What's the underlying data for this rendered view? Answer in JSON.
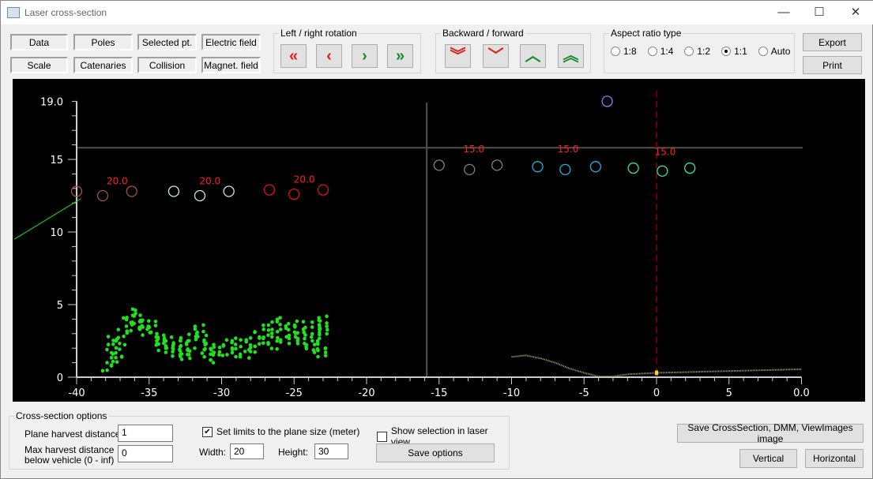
{
  "window": {
    "title": "Laser cross-section",
    "minimize": "—",
    "maximize": "☐",
    "close": "✕"
  },
  "toggles": {
    "data": "Data",
    "poles": "Poles",
    "selected": "Selected pt.",
    "electric": "Electric field",
    "scale": "Scale",
    "catenaries": "Catenaries",
    "collision": "Collision",
    "magnet": "Magnet. field"
  },
  "rotation": {
    "label": "Left / right rotation",
    "buttons": [
      "«",
      "‹",
      "›",
      "»"
    ]
  },
  "backfwd": {
    "label": "Backward / forward",
    "buttons": [
      "︾",
      "﹀",
      "︿",
      "︽"
    ]
  },
  "aspect": {
    "label": "Aspect ratio type",
    "options": [
      "1:8",
      "1:4",
      "1:2",
      "1:1",
      "Auto"
    ],
    "selected": "1:1"
  },
  "actions": {
    "export": "Export",
    "print": "Print"
  },
  "chart_data": {
    "type": "scatter",
    "xlim": [
      -40,
      10
    ],
    "ylim": [
      0,
      19
    ],
    "x_ticks": [
      "-40",
      "-35",
      "-30",
      "-25",
      "-20",
      "-15",
      "-10",
      "-5",
      "0",
      "5",
      "0.0"
    ],
    "y_ticks": [
      "0",
      "5",
      "10",
      "15",
      "19.0"
    ],
    "crosshair": {
      "x": -15.85,
      "y": 15.8
    },
    "vehicle_marker_x": 0,
    "poles": [
      {
        "x": -40,
        "y": 12.8,
        "color": "#a05050"
      },
      {
        "x": -38.2,
        "y": 12.5,
        "color": "#a05050"
      },
      {
        "x": -36.2,
        "y": 12.8,
        "color": "#a05050"
      },
      {
        "x": -33.3,
        "y": 12.8,
        "color": "#c8e8e8"
      },
      {
        "x": -31.5,
        "y": 12.5,
        "color": "#c8e8e8"
      },
      {
        "x": -29.5,
        "y": 12.8,
        "color": "#c8e8e8"
      },
      {
        "x": -26.7,
        "y": 12.9,
        "color": "#e01010"
      },
      {
        "x": -25,
        "y": 12.6,
        "color": "#e01010"
      },
      {
        "x": -23,
        "y": 12.9,
        "color": "#e01010"
      },
      {
        "x": -15,
        "y": 14.6,
        "color": "#808080"
      },
      {
        "x": -12.9,
        "y": 14.3,
        "color": "#808080"
      },
      {
        "x": -11,
        "y": 14.6,
        "color": "#808080"
      },
      {
        "x": -8.2,
        "y": 14.5,
        "color": "#20b0e0"
      },
      {
        "x": -6.3,
        "y": 14.3,
        "color": "#20b0e0"
      },
      {
        "x": -4.2,
        "y": 14.5,
        "color": "#20b0e0"
      },
      {
        "x": -1.6,
        "y": 14.4,
        "color": "#40e0a0"
      },
      {
        "x": 0.4,
        "y": 14.2,
        "color": "#40e0a0"
      },
      {
        "x": 2.3,
        "y": 14.4,
        "color": "#40e0a0"
      },
      {
        "x": -3.4,
        "y": 19.0,
        "color": "#8080ff"
      }
    ],
    "pole_labels": [
      {
        "text": "20.0",
        "x": -37.2,
        "y": 13.3
      },
      {
        "text": "20.0",
        "x": -30.8,
        "y": 13.3
      },
      {
        "text": "20.0",
        "x": -24.3,
        "y": 13.4
      },
      {
        "text": "15.0",
        "x": -12.6,
        "y": 15.5
      },
      {
        "text": "15.0",
        "x": -6.1,
        "y": 15.5
      },
      {
        "text": "15.0",
        "x": 0.6,
        "y": 15.3
      }
    ],
    "catenary_line": [
      [
        -44.3,
        9.5
      ],
      [
        -39.7,
        12.3
      ]
    ],
    "ground_profile": [
      [
        -10,
        1.4
      ],
      [
        -9,
        1.5
      ],
      [
        -8,
        1.3
      ],
      [
        -7,
        1.0
      ],
      [
        -6,
        0.6
      ],
      [
        -5,
        0.3
      ],
      [
        -4,
        0.05
      ],
      [
        -3,
        0.05
      ],
      [
        -2,
        0.2
      ],
      [
        -1,
        0.25
      ],
      [
        0,
        0.3
      ],
      [
        2,
        0.35
      ],
      [
        4,
        0.4
      ],
      [
        6,
        0.45
      ],
      [
        8,
        0.5
      ],
      [
        10,
        0.55
      ]
    ],
    "vegetation": [
      [
        -37.9,
        0.7
      ],
      [
        -37.6,
        1.6
      ],
      [
        -37.2,
        1.3
      ],
      [
        -37.5,
        2.5
      ],
      [
        -37,
        2.2
      ],
      [
        -36.8,
        3.0
      ],
      [
        -36.5,
        3.8
      ],
      [
        -36.2,
        4.4
      ],
      [
        -36.0,
        3.5
      ],
      [
        -35.7,
        4.0
      ],
      [
        -35.4,
        3.6
      ],
      [
        -35.1,
        3.2
      ],
      [
        -34.9,
        3.6
      ],
      [
        -34.6,
        2.8
      ],
      [
        -34.3,
        2.5
      ],
      [
        -34.0,
        2.0
      ],
      [
        -33.8,
        2.6
      ],
      [
        -33.5,
        2.2
      ],
      [
        -33.2,
        1.7
      ],
      [
        -33.0,
        2.4
      ],
      [
        -32.7,
        1.8
      ],
      [
        -32.4,
        1.5
      ],
      [
        -32.2,
        2.2
      ],
      [
        -31.9,
        2.8
      ],
      [
        -31.6,
        3.3
      ],
      [
        -31.3,
        2.6
      ],
      [
        -31.1,
        1.7
      ],
      [
        -30.8,
        2.0
      ],
      [
        -30.5,
        1.3
      ],
      [
        -30.2,
        1.8
      ],
      [
        -29.6,
        2.3
      ],
      [
        -29.3,
        1.7
      ],
      [
        -29.0,
        2.4
      ],
      [
        -28.4,
        1.6
      ],
      [
        -28.0,
        2.4
      ],
      [
        -27.7,
        2.0
      ],
      [
        -27.4,
        3.0
      ],
      [
        -27.1,
        2.6
      ],
      [
        -26.8,
        3.5
      ],
      [
        -26.5,
        2.2
      ],
      [
        -26.2,
        3.0
      ],
      [
        -25.9,
        3.8
      ],
      [
        -25.6,
        2.6
      ],
      [
        -25.3,
        3.4
      ],
      [
        -25.0,
        2.8
      ],
      [
        -24.7,
        3.6
      ],
      [
        -24.4,
        2.4
      ],
      [
        -24.1,
        3.2
      ],
      [
        -23.8,
        2.0
      ],
      [
        -23.6,
        2.8
      ],
      [
        -23.4,
        3.6
      ],
      [
        -23.1,
        3.9
      ],
      [
        -23.0,
        1.7
      ],
      [
        -23.2,
        2.2
      ],
      [
        -22.9,
        3.2
      ]
    ]
  },
  "options": {
    "label": "Cross-section options",
    "plane_label": "Plane harvest distance",
    "plane_value": "1",
    "max_label1": "Max harvest distance",
    "max_label2": "below vehicle (0 - inf)",
    "max_value": "0",
    "limits_label": "Set limits to the plane size (meter)",
    "limits_checked": true,
    "width_label": "Width:",
    "width_value": "20",
    "height_label": "Height:",
    "height_value": "30",
    "show_sel_label": "Show selection in laser view",
    "show_sel_checked": false,
    "save": "Save options"
  },
  "bottom": {
    "save_image": "Save CrossSection, DMM, ViewImages image",
    "vertical": "Vertical",
    "horizontal": "Horizontal"
  }
}
